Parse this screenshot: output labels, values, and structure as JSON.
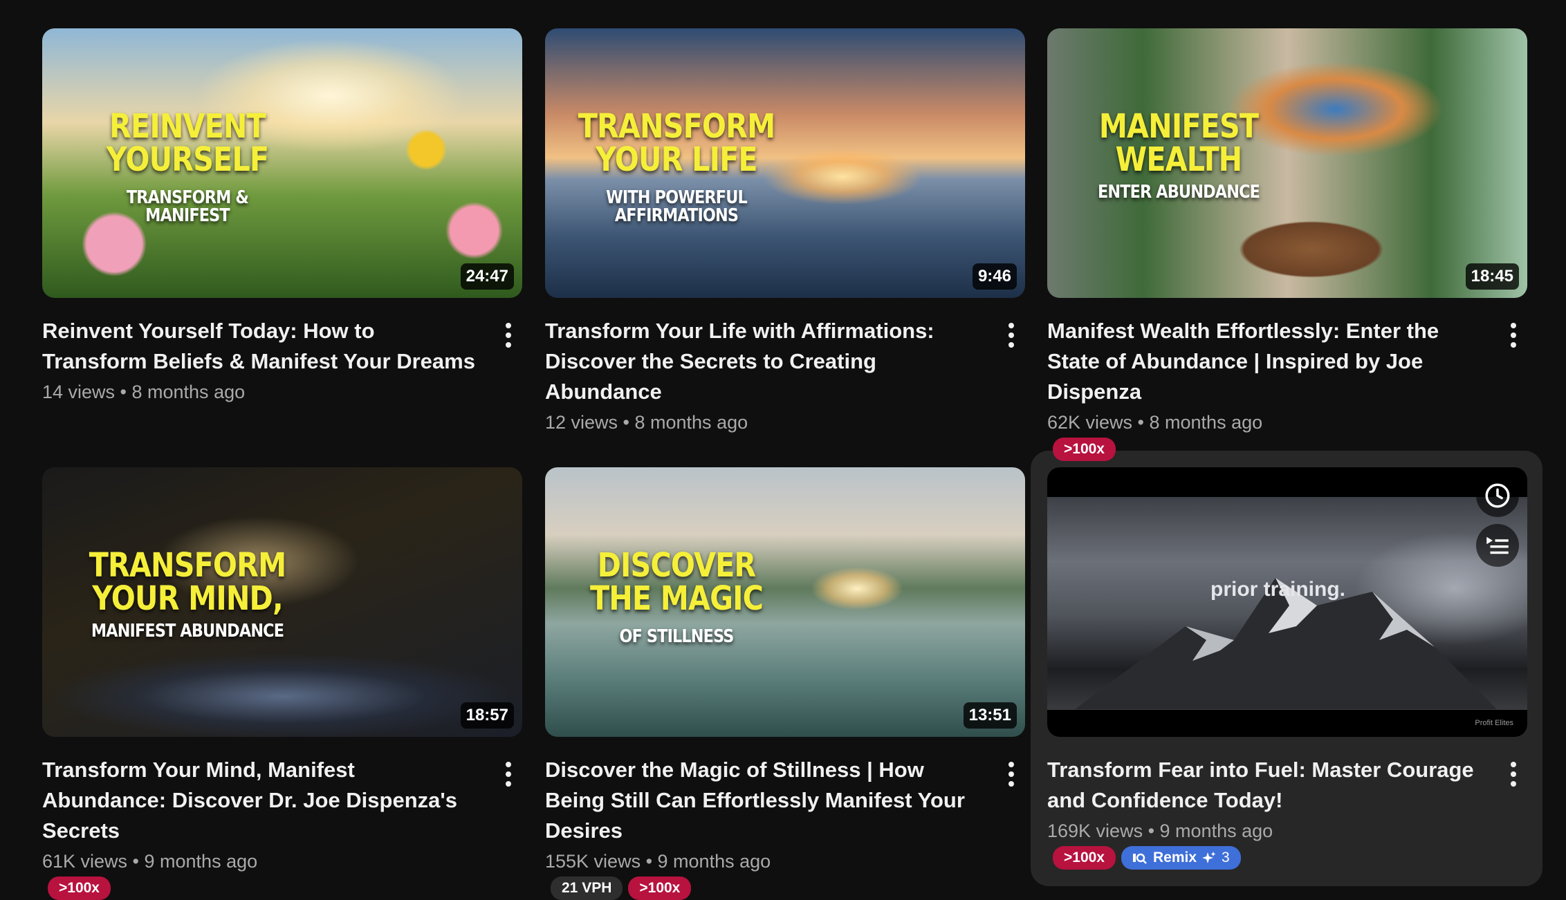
{
  "videos": [
    {
      "duration": "24:47",
      "thumb_text_big": "REINVENT YOURSELF",
      "thumb_text_small": "TRANSFORM & MANIFEST",
      "title": "Reinvent Yourself Today: How to Transform Beliefs & Manifest Your Dreams",
      "meta": "14 views • 8 months ago"
    },
    {
      "duration": "9:46",
      "thumb_text_big": "TRANSFORM YOUR LIFE",
      "thumb_text_small": "WITH POWERFUL AFFIRMATIONS",
      "title": "Transform Your Life with Affirmations: Discover the Secrets to Creating Abundance",
      "meta": "12 views • 8 months ago"
    },
    {
      "duration": "18:45",
      "thumb_text_big": "MANIFEST WEALTH",
      "thumb_text_small": "ENTER ABUNDANCE",
      "title": "Manifest Wealth Effortlessly: Enter the State of Abundance | Inspired by Joe Dispenza",
      "meta": "62K views • 8 months ago",
      "badge_outlier": ">100x"
    },
    {
      "duration": "18:57",
      "thumb_text_big": "TRANSFORM YOUR MIND,",
      "thumb_text_small": "MANIFEST ABUNDANCE",
      "title": "Transform Your Mind, Manifest Abundance: Discover Dr. Joe Dispenza's Secrets",
      "meta": "61K views • 9 months ago",
      "badge_outlier": ">100x"
    },
    {
      "duration": "13:51",
      "thumb_text_big": "DISCOVER THE MAGIC",
      "thumb_text_small": "OF STILLNESS",
      "title": "Discover the Magic of Stillness | How Being Still Can Effortlessly Manifest Your Desires",
      "meta": "155K views • 9 months ago",
      "badge_vph": "21 VPH",
      "badge_outlier": ">100x"
    },
    {
      "thumb_caption": "prior training.",
      "thumb_watermark": "Profit Elites",
      "title": "Transform Fear into Fuel: Master Courage and Confidence Today!",
      "meta": "169K views • 9 months ago",
      "badge_outlier": ">100x",
      "remix_label": "Remix",
      "remix_count": "3"
    }
  ],
  "icons": {
    "watch_later": "clock-icon",
    "add_to_queue": "add-to-queue-icon",
    "more": "more-vertical-icon",
    "remix": "remix-icon",
    "sparkle": "sparkle-icon"
  },
  "colors": {
    "background": "#0f0f0f",
    "hover_card": "#272727",
    "thumb_title_yellow": "#f5ef3a",
    "badge_red": "#b8123f",
    "badge_blue": "#3f6fd8"
  }
}
